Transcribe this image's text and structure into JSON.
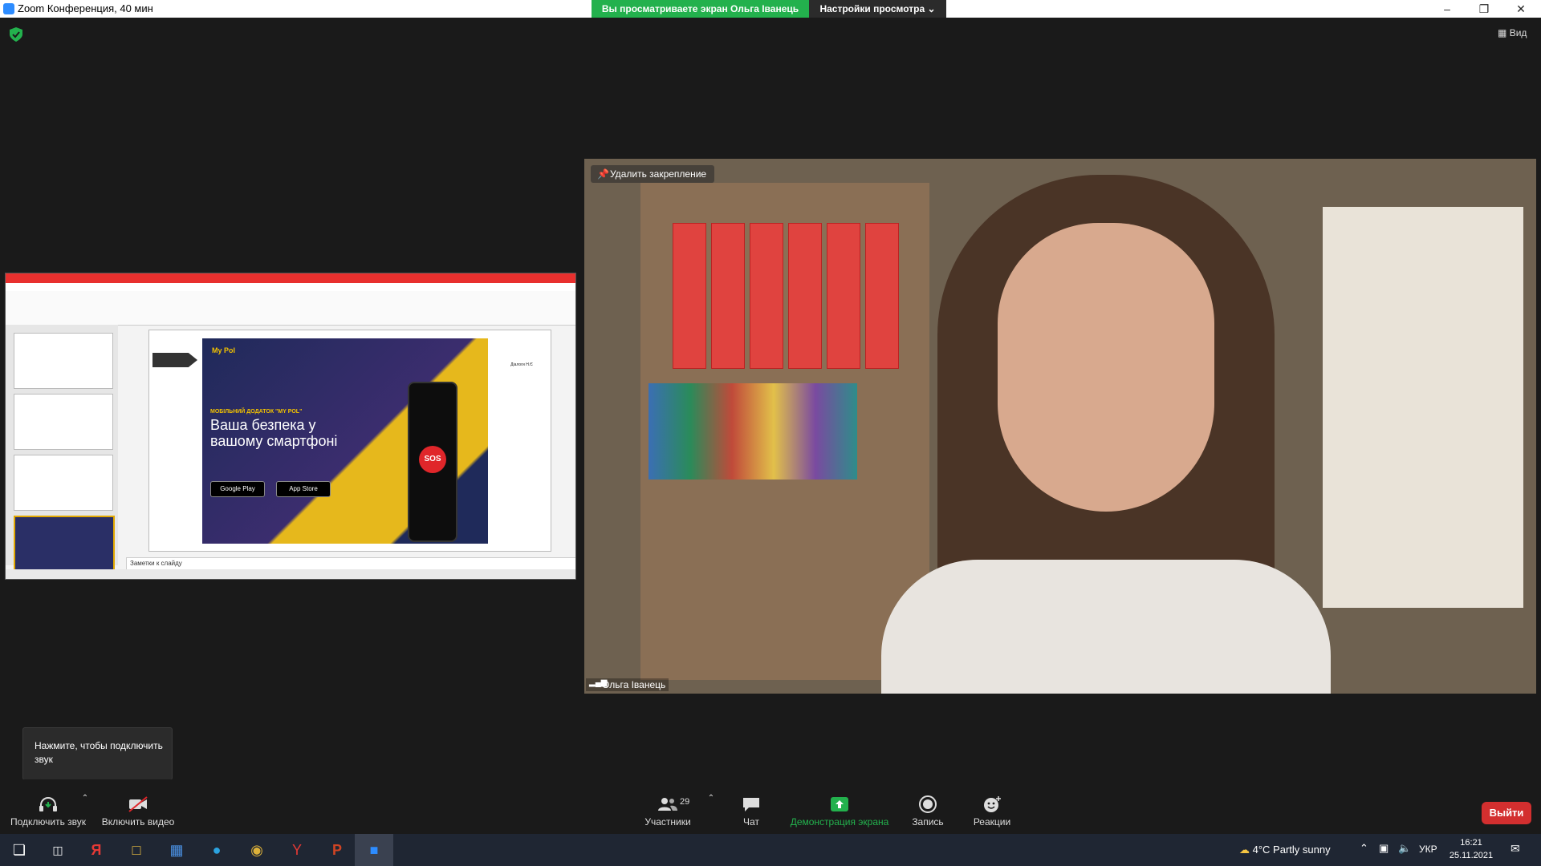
{
  "window": {
    "title": "Zoom Конференция, 40 мин"
  },
  "banner": {
    "viewing": "Вы просматриваете экран Ольга Іванець",
    "view_settings": "Настройки просмотра ⌄"
  },
  "top": {
    "view_label": "Вид"
  },
  "share": {
    "notes_placeholder": "Заметки к слайду",
    "slide": {
      "brand": "My Pol",
      "heading": "МОБІЛЬНИЙ ДОДАТОК \"MY POL\"",
      "main_text": "Ваша безпека у вашому смартфоні",
      "google_play": "Google Play",
      "app_store": "App Store",
      "sos": "SOS",
      "logo_text": "Діалоги Н.Є"
    }
  },
  "video": {
    "unpin_label": "Удалить закрепление",
    "participant_name": "Ольга Іванець"
  },
  "tooltip": {
    "text": "Нажмите, чтобы подключить звук"
  },
  "toolbar": {
    "audio": "Подключить звук",
    "video": "Включить видео",
    "participants": "Участники",
    "participants_count": "29",
    "chat": "Чат",
    "share": "Демонстрация экрана",
    "record": "Запись",
    "reactions": "Реакции",
    "leave": "Выйти"
  },
  "taskbar": {
    "weather": "4°C  Partly sunny",
    "language": "УКР",
    "time": "16:21",
    "date": "25.11.2021"
  },
  "colors": {
    "share_green": "#23b14d",
    "leave_red": "#d32f2f",
    "accent_blue": "#2d8cff"
  }
}
